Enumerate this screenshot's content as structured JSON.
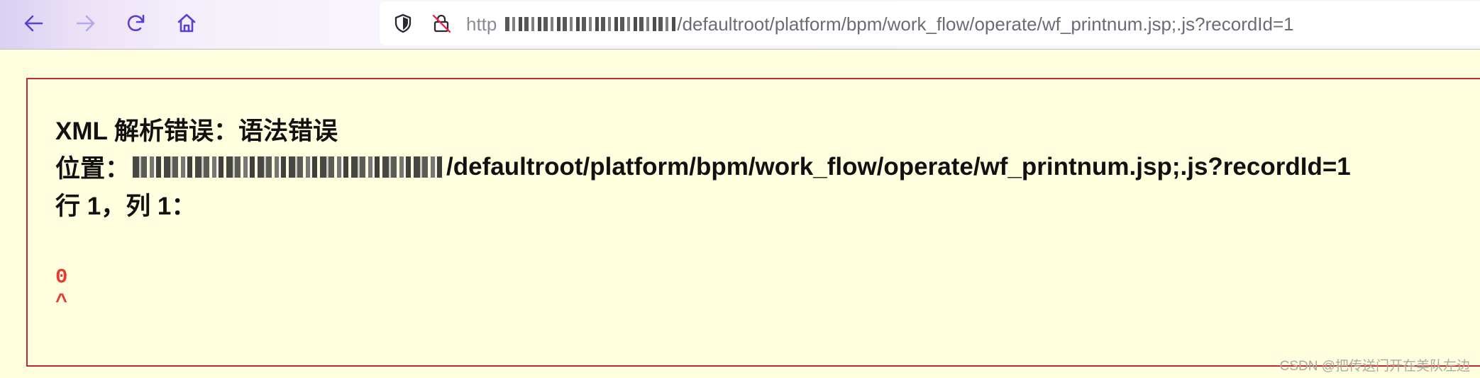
{
  "browser": {
    "url": {
      "scheme_prefix": "http",
      "path": "/defaultroot/platform/bpm/work_flow/operate/wf_printnum.jsp;.js?recordId=1"
    },
    "icons": {
      "back": "arrow-left-icon",
      "forward": "arrow-right-icon",
      "reload": "reload-icon",
      "home": "home-icon",
      "shield": "shield-icon",
      "insecure_lock": "insecure-lock-icon"
    },
    "colors": {
      "accent": "#5b3fd1"
    }
  },
  "error": {
    "title": "XML 解析错误：语法错误",
    "location_label": "位置：",
    "location_path": "/defaultroot/platform/bpm/work_flow/operate/wf_printnum.jsp;.js?recordId=1",
    "position": "行 1，列 1：",
    "source_text": "0",
    "caret": "^",
    "colors": {
      "border": "#c0282e",
      "source": "#e43c32",
      "background": "#ffffe0"
    }
  },
  "watermark": "CSDN @把传送门开在美队左边"
}
